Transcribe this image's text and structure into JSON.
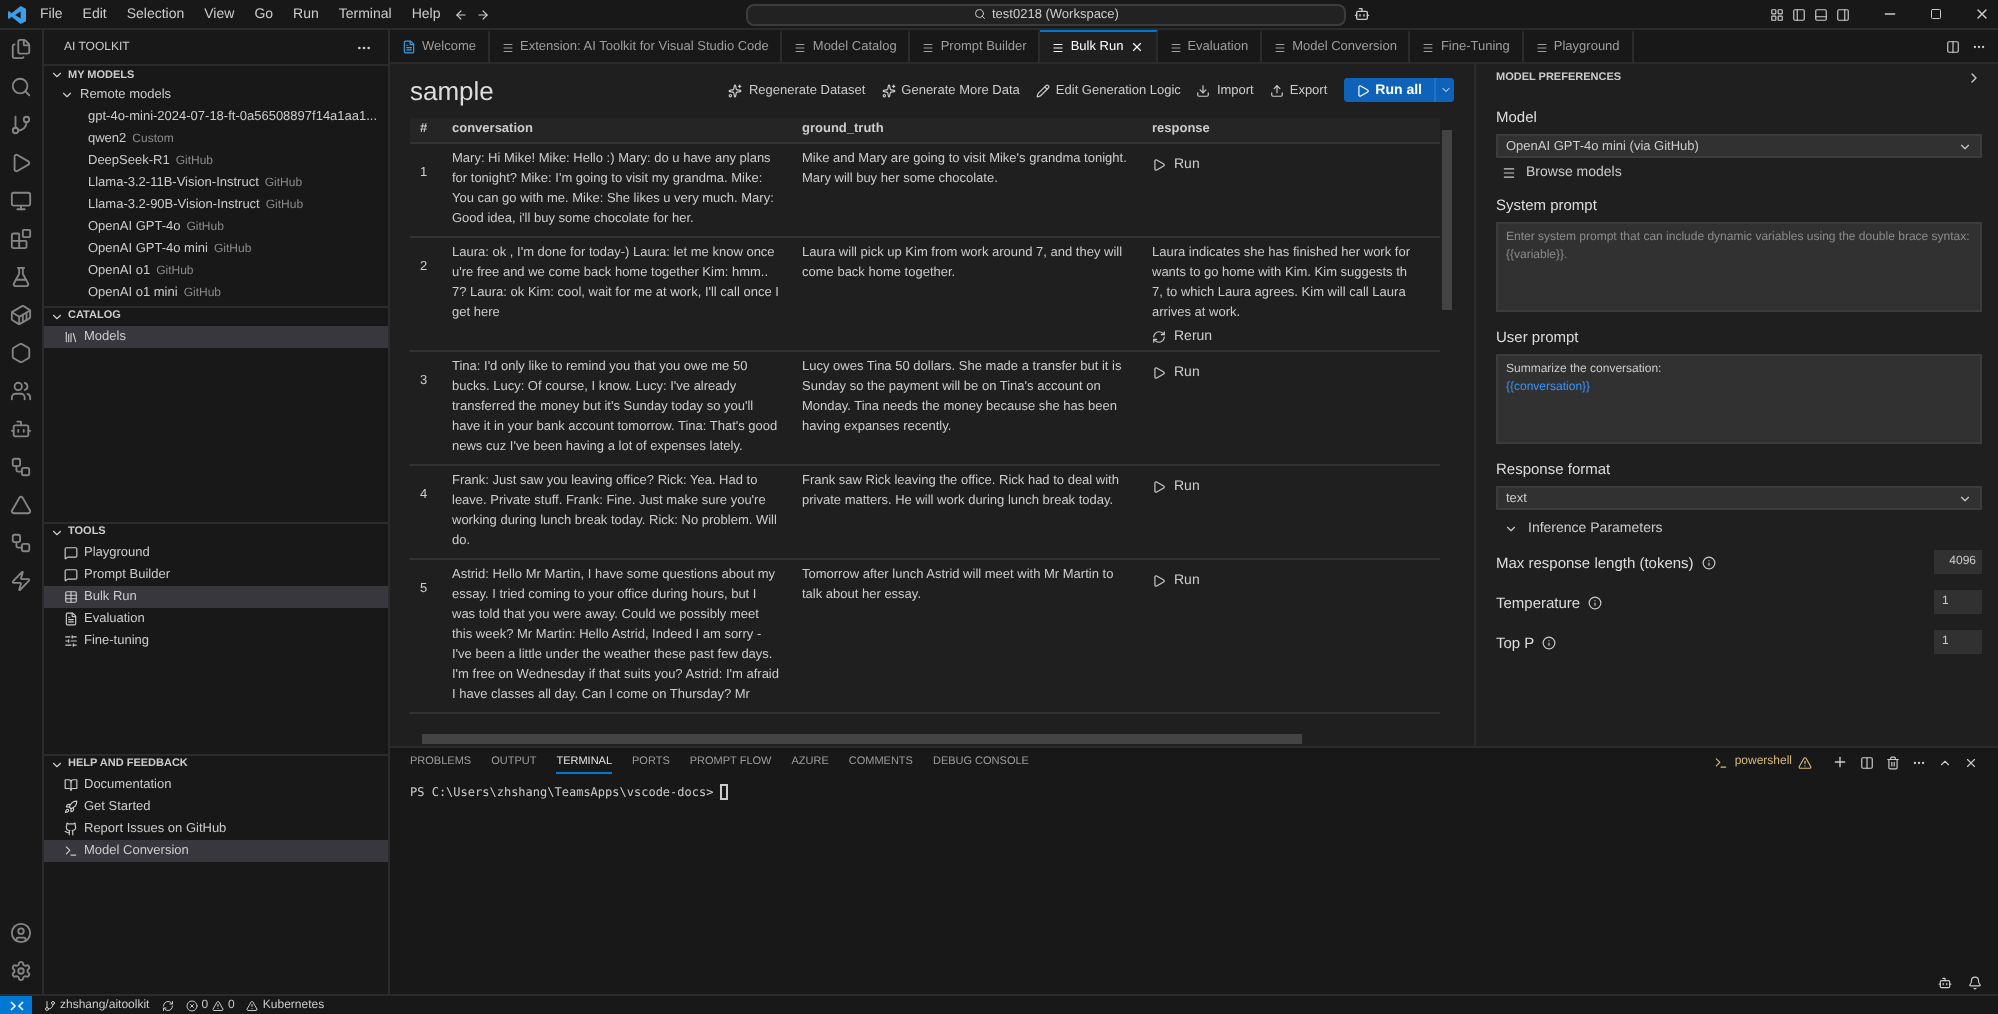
{
  "menu": [
    "File",
    "Edit",
    "Selection",
    "View",
    "Go",
    "Run",
    "Terminal",
    "Help"
  ],
  "search": {
    "value": "test0218 (Workspace)"
  },
  "sidebar": {
    "title": "AI TOOLKIT",
    "sections": [
      {
        "title": "MY MODELS",
        "expanded": true,
        "groups": [
          {
            "title": "Remote models",
            "expanded": true,
            "items": [
              {
                "label": "gpt-4o-mini-2024-07-18-ft-0a56508897f14a1aa1..."
              },
              {
                "label": "qwen2",
                "tag": "Custom"
              },
              {
                "label": "DeepSeek-R1",
                "tag": "GitHub"
              },
              {
                "label": "Llama-3.2-11B-Vision-Instruct",
                "tag": "GitHub"
              },
              {
                "label": "Llama-3.2-90B-Vision-Instruct",
                "tag": "GitHub"
              },
              {
                "label": "OpenAI GPT-4o",
                "tag": "GitHub"
              },
              {
                "label": "OpenAI GPT-4o mini",
                "tag": "GitHub"
              },
              {
                "label": "OpenAI o1",
                "tag": "GitHub"
              },
              {
                "label": "OpenAI o1 mini",
                "tag": "GitHub"
              }
            ]
          }
        ]
      },
      {
        "title": "CATALOG",
        "expanded": true,
        "items": [
          {
            "label": "Models",
            "selected": true
          }
        ]
      },
      {
        "title": "TOOLS",
        "expanded": true,
        "items": [
          {
            "label": "Playground",
            "selected": false
          },
          {
            "label": "Prompt Builder",
            "selected": false
          },
          {
            "label": "Bulk Run",
            "selected": true
          },
          {
            "label": "Evaluation",
            "selected": false
          },
          {
            "label": "Fine-tuning",
            "selected": false
          }
        ]
      },
      {
        "title": "HELP AND FEEDBACK",
        "expanded": true,
        "items": [
          {
            "label": "Documentation",
            "selected": false
          },
          {
            "label": "Get Started",
            "selected": false
          },
          {
            "label": "Report Issues on GitHub",
            "selected": false
          },
          {
            "label": "Model Conversion",
            "selected": true
          }
        ]
      }
    ]
  },
  "tabs": [
    {
      "label": "Welcome",
      "selected": false
    },
    {
      "label": "Extension: AI Toolkit for Visual Studio Code",
      "selected": false
    },
    {
      "label": "Model Catalog",
      "selected": false
    },
    {
      "label": "Prompt Builder",
      "selected": false
    },
    {
      "label": "Bulk Run",
      "selected": true
    },
    {
      "label": "Evaluation",
      "selected": false
    },
    {
      "label": "Model Conversion",
      "selected": false
    },
    {
      "label": "Fine-Tuning",
      "selected": false
    },
    {
      "label": "Playground",
      "selected": false
    }
  ],
  "editor": {
    "title": "sample",
    "actions": [
      "Regenerate Dataset",
      "Generate More Data",
      "Edit Generation Logic",
      "Import",
      "Export"
    ],
    "primary": "Run all",
    "table": {
      "columns": [
        "#",
        "conversation",
        "ground_truth",
        "response"
      ],
      "rows": [
        {
          "index": "1",
          "conversation": "Mary: Hi Mike! Mike: Hello :) Mary: do u have any plans for tonight? Mike: I'm going to visit my grandma. Mike: You can go with me. Mike: She likes u very much. Mary: Good idea, i'll buy some chocolate for her.",
          "ground_truth": "Mike and Mary are going to visit Mike's grandma tonight. Mary will buy her some chocolate.",
          "response": {
            "kind": "run",
            "button": "Run"
          }
        },
        {
          "index": "2",
          "conversation": "Laura: ok , I'm done for today-) Laura: let me know once u're free and we come back home together Kim: hmm.. 7? Laura: ok Kim: cool, wait for me at work, I'll call once I get here",
          "ground_truth": "Laura will pick up Kim from work around 7, and they will come back home together.",
          "response": {
            "kind": "result",
            "lines": [
              "Laura indicates she has finished her work for",
              "wants to go home with Kim. Kim suggests th",
              "7, to which Laura agrees. Kim will call Laura",
              "arrives at work."
            ],
            "button": "Rerun"
          }
        },
        {
          "index": "3",
          "conversation": "Tina: I'd only like to remind you that you owe me 50 bucks. Lucy: Of course, I know. Lucy: I've already transferred the money but it's Sunday today so you'll have it in your bank account tomorrow. Tina: That's good news cuz I've been having a lot of expenses lately.",
          "ground_truth": "Lucy owes Tina 50 dollars. She made a transfer but it is Sunday so the payment will be on Tina's account on Monday. Tina needs the money because she has been having expanses recently.",
          "response": {
            "kind": "run",
            "button": "Run"
          }
        },
        {
          "index": "4",
          "conversation": "Frank: Just saw you leaving office? Rick: Yea. Had to leave. Private stuff. Frank: Fine. Just make sure you're working during lunch break today. Rick: No problem. Will do.",
          "ground_truth": "Frank saw Rick leaving the office. Rick had to deal with private matters. He will work during lunch break today.",
          "response": {
            "kind": "run",
            "button": "Run"
          }
        },
        {
          "index": "5",
          "conversation": "Astrid: Hello Mr Martin, I have some questions about my essay. I tried coming to your office during hours, but I was told that you were away. Could we possibly meet this week? Mr Martin: Hello Astrid, Indeed I am sorry - I've been a little under the weather these past few days. I'm free on Wednesday if that suits you? Astrid: I'm afraid I have classes all day. Can I come on Thursday? Mr",
          "ground_truth": "Tomorrow after lunch Astrid will meet with Mr Martin to talk about her essay.",
          "response": {
            "kind": "run",
            "button": "Run"
          }
        }
      ]
    }
  },
  "preferences": {
    "title": "MODEL PREFERENCES",
    "model_label": "Model",
    "model": "OpenAI GPT-4o mini (via GitHub)",
    "browse": "Browse models",
    "system_label": "System prompt",
    "system_placeholder": "Enter system prompt that can include dynamic variables using the double brace syntax: {{variable}}.",
    "user_label": "User prompt",
    "user_value": [
      {
        "kind": "plain",
        "text": "Summarize the conversation:"
      },
      {
        "kind": "variable",
        "text": "{{conversation}}"
      }
    ],
    "format_label": "Response format",
    "format": "text",
    "inference": {
      "title": "Inference Parameters",
      "expanded": true,
      "params": [
        {
          "label": "Max response length (tokens)",
          "value": "4096"
        },
        {
          "label": "Temperature",
          "value": "1"
        },
        {
          "label": "Top P",
          "value": "1"
        }
      ]
    }
  },
  "panel": {
    "tabs": [
      {
        "label": "PROBLEMS",
        "selected": false
      },
      {
        "label": "OUTPUT",
        "selected": false
      },
      {
        "label": "TERMINAL",
        "selected": true
      },
      {
        "label": "PORTS",
        "selected": false
      },
      {
        "label": "PROMPT FLOW",
        "selected": false
      },
      {
        "label": "AZURE",
        "selected": false
      },
      {
        "label": "COMMENTS",
        "selected": false
      },
      {
        "label": "DEBUG CONSOLE",
        "selected": false
      }
    ],
    "shell": "powershell",
    "prompt": "PS C:\\Users\\zhshang\\TeamsApps\\vscode-docs>"
  },
  "status_bar": {
    "branch": "zhshang/aitoolkit",
    "errors": "0",
    "warnings": "0",
    "kubernetes": "Kubernetes"
  }
}
